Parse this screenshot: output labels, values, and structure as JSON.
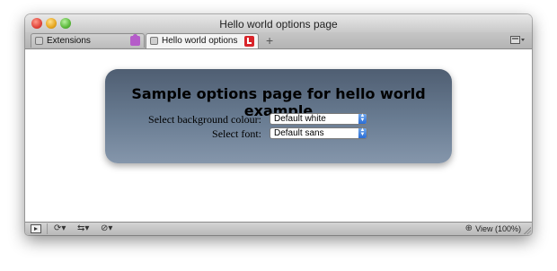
{
  "window": {
    "title": "Hello world options page"
  },
  "tabs": [
    {
      "label": "Extensions",
      "favicon": "page-icon",
      "badge_icon": "puzzle-icon",
      "active": false
    },
    {
      "label": "Hello world options ...",
      "favicon": "page-icon",
      "badge_icon": "close-tab-icon",
      "active": true
    }
  ],
  "toolbar": {
    "new_tab_symbol": "+",
    "menu_icon": "tab-menu-icon"
  },
  "options_page": {
    "heading": "Sample options page for hello world example",
    "background": {
      "label": "Select background colour:",
      "selected": "Default white"
    },
    "font": {
      "label": "Select font:",
      "selected": "Default sans"
    }
  },
  "statusbar": {
    "zoom": "View (100%)",
    "icons": [
      "panel-toggle-icon",
      "sync-icon",
      "network-icon",
      "block-icon",
      "zoom-icon"
    ]
  },
  "colors": {
    "panel_top": "#4f5e72",
    "panel_bottom": "#8596ab",
    "select_arrow": "#2a6dd6",
    "close_tab": "#d8242a",
    "puzzle": "#b55cc9"
  }
}
